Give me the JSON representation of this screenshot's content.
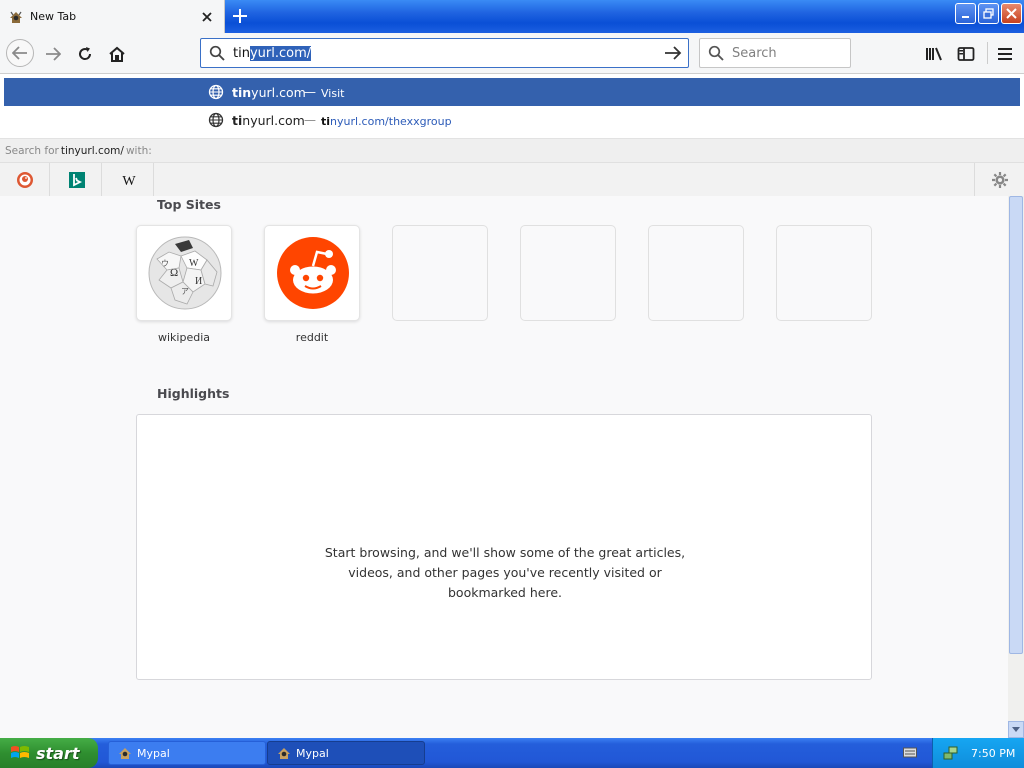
{
  "browser": {
    "tab": {
      "title": "New Tab"
    },
    "urlbar": {
      "typed": "tin",
      "completion": "yurl.com/"
    },
    "searchbar": {
      "placeholder": "Search"
    }
  },
  "autocomplete": {
    "rows": [
      {
        "title_bold": "tin",
        "title_rest": "yurl.com",
        "dash": "—",
        "action": "Visit"
      },
      {
        "title_bold": "ti",
        "title_rest": "nyurl.com",
        "dash": "—",
        "url_bold": "ti",
        "url_rest": "nyurl.com/thexxgroup"
      }
    ],
    "search_for": {
      "prefix": "Search for",
      "query": "tinyurl.com/",
      "suffix": "with:"
    },
    "engines": [
      "duckduckgo-icon",
      "bing-icon",
      "wikipedia-icon"
    ]
  },
  "newtab": {
    "top_sites_title": "Top Sites",
    "top_sites": [
      {
        "label": "wikipedia",
        "icon": "wikipedia-icon"
      },
      {
        "label": "reddit",
        "icon": "reddit-icon"
      }
    ],
    "highlights_title": "Highlights",
    "highlights_message": [
      "Start browsing, and we'll show some of the great articles,",
      "videos, and other pages you've recently visited or",
      "bookmarked here."
    ]
  },
  "taskbar": {
    "start_label": "start",
    "items": [
      {
        "label": "Mypal",
        "active": false
      },
      {
        "label": "Mypal",
        "active": true
      }
    ],
    "clock": "7:50 PM"
  },
  "colors": {
    "selection": "#3461ad",
    "reddit": "#ff4500",
    "xp_blue": "#245edb",
    "start_green": "#2f8f30"
  }
}
